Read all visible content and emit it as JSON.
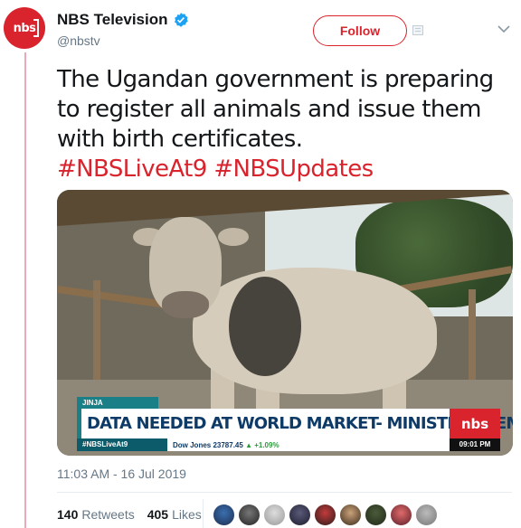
{
  "account": {
    "avatar_text": "nbs",
    "display_name": "NBS Television",
    "handle": "@nbstv",
    "follow_label": "Follow"
  },
  "tweet": {
    "text": "The Ugandan government is preparing to register all animals and issue them with birth certificates.",
    "hashtags": "#NBSLiveAt9 #NBSUpdates",
    "timestamp": "11:03 AM - 16 Jul 2019"
  },
  "media": {
    "ticker_tag": "JINJA",
    "headline": "DATA NEEDED AT WORLD MARKET- MINISTER SSEMPIJJA",
    "ticker_hashtag": "#NBSLiveAt9",
    "market_label": "Dow Jones 23787.45",
    "market_change": "▲ +1.09%",
    "logo_text": "nbs",
    "clock": "09:01 PM"
  },
  "stats": {
    "retweets_count": "140",
    "retweets_label": "Retweets",
    "likes_count": "405",
    "likes_label": "Likes"
  },
  "icons": [
    "verified-icon",
    "page-icon",
    "chevron-down-icon"
  ],
  "colors": {
    "brand_red": "#d9232d",
    "verified_blue": "#1da1f2",
    "muted": "#657786",
    "ticker_teal": "#1b7f87"
  }
}
